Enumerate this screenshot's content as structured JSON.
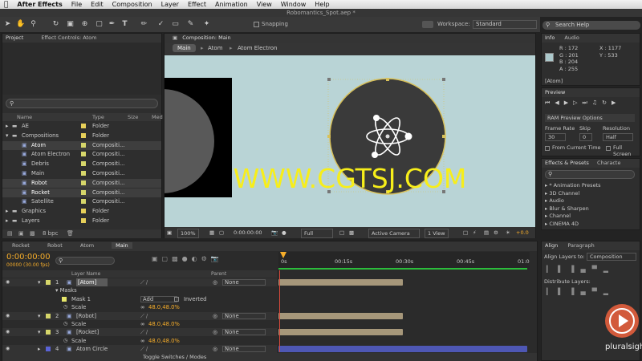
{
  "menu": {
    "apple": "",
    "app": "After Effects",
    "items": [
      "File",
      "Edit",
      "Composition",
      "Layer",
      "Effect",
      "Animation",
      "View",
      "Window",
      "Help"
    ]
  },
  "title": "Robomantics_Spot.aep *",
  "toolbar": {
    "snapping": "Snapping",
    "workspace_label": "Workspace:",
    "workspace_value": "Standard",
    "search_help": "Search Help"
  },
  "project": {
    "tab1": "Project",
    "tab2": "Effect Controls: Atom",
    "cols": [
      "Name",
      "Type",
      "Size",
      "Med"
    ],
    "rows": [
      {
        "name": "AE",
        "type": "Folder",
        "color": "#e6cf59"
      },
      {
        "name": "Compositions",
        "type": "Folder",
        "color": "#e6cf59"
      },
      {
        "name": "Atom",
        "type": "Compositi...",
        "color": "#d6d66a"
      },
      {
        "name": "Atom Electron",
        "type": "Compositi...",
        "color": "#d6d66a"
      },
      {
        "name": "Debris",
        "type": "Compositi...",
        "color": "#d6d66a"
      },
      {
        "name": "Main",
        "type": "Compositi...",
        "color": "#d6d66a"
      },
      {
        "name": "Robot",
        "type": "Compositi...",
        "color": "#d6d66a"
      },
      {
        "name": "Rocket",
        "type": "Compositi...",
        "color": "#d6d66a"
      },
      {
        "name": "Satellite",
        "type": "Compositi...",
        "color": "#d6d66a"
      },
      {
        "name": "Graphics",
        "type": "Folder",
        "color": "#e6cf59"
      },
      {
        "name": "Layers",
        "type": "Folder",
        "color": "#e6cf59"
      }
    ],
    "bpc": "8 bpc"
  },
  "comp": {
    "tab": "Composition: Main",
    "crumbs": [
      "Main",
      "Atom",
      "Atom Electron"
    ],
    "footer": {
      "zoom": "100%",
      "time": "0:00:00:00",
      "res": "Full",
      "camera": "Active Camera",
      "view": "1 View",
      "exposure": "+0.0"
    }
  },
  "watermark": "WWW.CGTSJ.COM",
  "info": {
    "tab1": "Info",
    "tab2": "Audio",
    "r": "R : 172",
    "g": "G : 201",
    "b": "B : 204",
    "a": "A : 255",
    "x": "X : 1177",
    "y": "Y : 533",
    "layer": "[Atom]",
    "color": "#acc9cc"
  },
  "preview": {
    "tab": "Preview",
    "ram": "RAM Preview Options",
    "frame_rate_label": "Frame Rate",
    "skip_label": "Skip",
    "resolution_label": "Resolution",
    "frame_rate": "30",
    "skip": "0",
    "resolution": "Half",
    "from_current": "From Current Time",
    "full_screen": "Full Screen"
  },
  "effects": {
    "tab1": "Effects & Presets",
    "tab2": "Characte",
    "search": "",
    "items": [
      "* Animation Presets",
      "3D Channel",
      "Audio",
      "Blur & Sharpen",
      "Channel",
      "CINEMA 4D"
    ]
  },
  "align": {
    "tab1": "Align",
    "tab2": "Paragraph",
    "align_to_label": "Align Layers to:",
    "align_to": "Composition",
    "distribute": "Distribute Layers:"
  },
  "timeline": {
    "tabs": [
      "Rocket",
      "Robot",
      "Atom",
      "Main"
    ],
    "timecode": "0:00:00:00",
    "fps": "00000 (30.00 fps)",
    "ticks": [
      "0s",
      "00:15s",
      "00:30s",
      "00:45s",
      "01:0"
    ],
    "header": {
      "layer_name": "Layer Name",
      "parent": "Parent"
    },
    "rows": [
      {
        "kind": "layer",
        "num": "1",
        "name": "[Atom]",
        "parent": "None",
        "color": "#d6d66a"
      },
      {
        "kind": "group",
        "name": "Masks"
      },
      {
        "kind": "mask",
        "name": "Mask 1",
        "mode": "Add",
        "inverted": "Inverted"
      },
      {
        "kind": "prop",
        "name": "Scale",
        "value": "48.0,48.0%"
      },
      {
        "kind": "layer",
        "num": "2",
        "name": "[Robot]",
        "parent": "None",
        "color": "#d6d66a"
      },
      {
        "kind": "prop",
        "name": "Scale",
        "value": "48.0,48.0%"
      },
      {
        "kind": "layer",
        "num": "3",
        "name": "[Rocket]",
        "parent": "None",
        "color": "#d6d66a"
      },
      {
        "kind": "prop",
        "name": "Scale",
        "value": "48.0,48.0%"
      },
      {
        "kind": "layer",
        "num": "4",
        "name": "Atom Circle",
        "parent": "None",
        "color": "#5a63d6"
      }
    ],
    "toggle": "Toggle Switches / Modes"
  },
  "brand": "pluralsight"
}
